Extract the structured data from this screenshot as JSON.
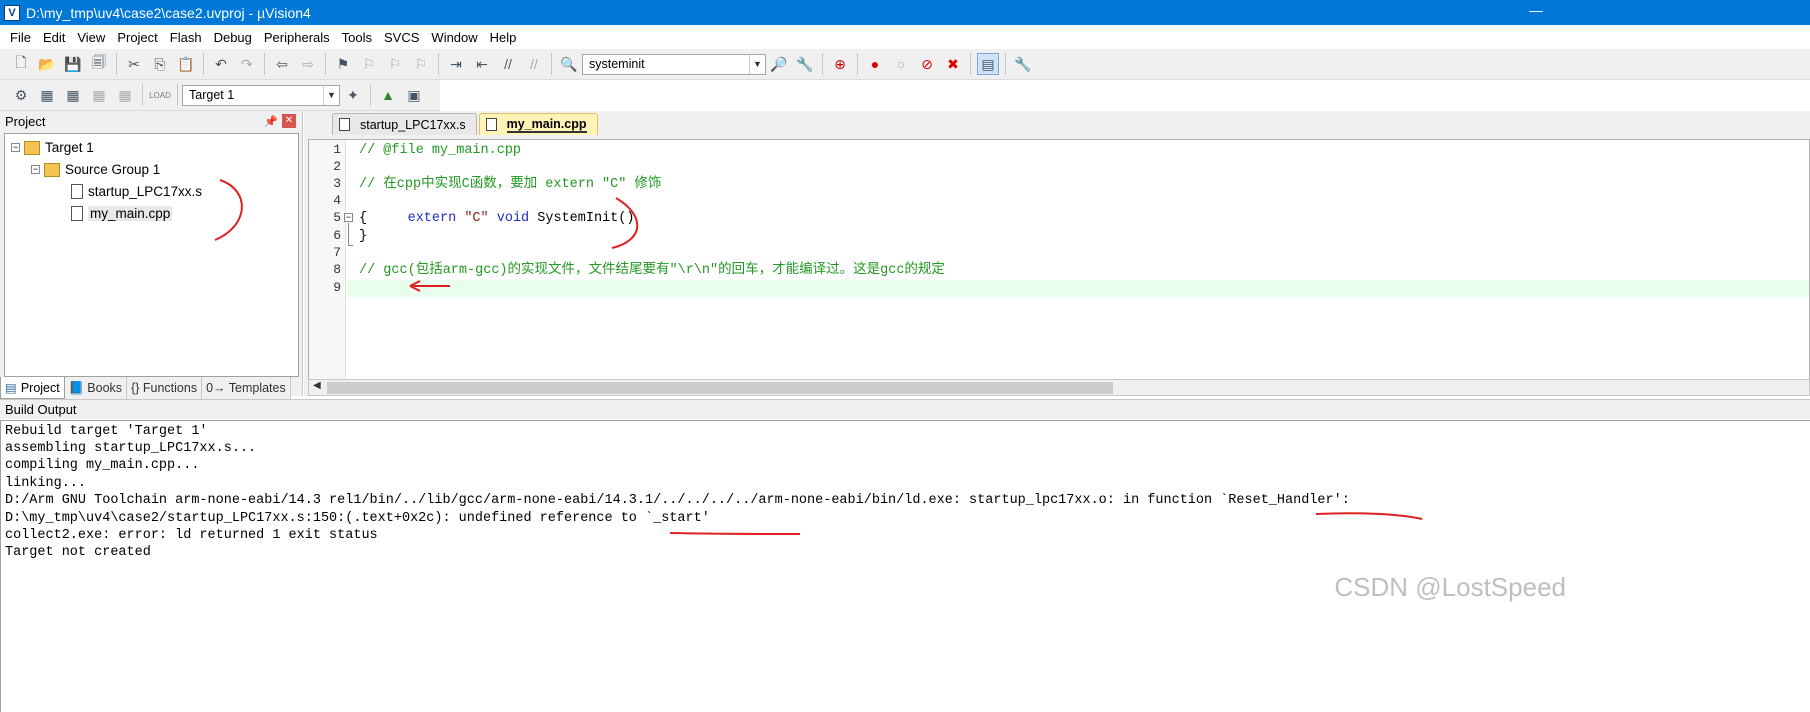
{
  "window": {
    "title": "D:\\my_tmp\\uv4\\case2\\case2.uvproj - µVision4"
  },
  "menu": [
    "File",
    "Edit",
    "View",
    "Project",
    "Flash",
    "Debug",
    "Peripherals",
    "Tools",
    "SVCS",
    "Window",
    "Help"
  ],
  "toolbar1": {
    "find_combo_value": "systeminit"
  },
  "toolbar2": {
    "load_label": "LOAD",
    "target_combo_value": "Target 1"
  },
  "project_panel": {
    "title": "Project",
    "tree": {
      "target": "Target 1",
      "group": "Source Group 1",
      "files": [
        "startup_LPC17xx.s",
        "my_main.cpp"
      ]
    },
    "tabs": [
      "Project",
      "Books",
      "{} Functions",
      "0→ Templates"
    ]
  },
  "editor": {
    "tabs": [
      {
        "label": "startup_LPC17xx.s",
        "active": false
      },
      {
        "label": "my_main.cpp",
        "active": true
      }
    ],
    "line_numbers": [
      "1",
      "2",
      "3",
      "4",
      "5",
      "6",
      "7",
      "8",
      "9"
    ],
    "lines": [
      "// @file my_main.cpp",
      "",
      "// 在cpp中实现C函数，要加 extern \"C\" 修饰",
      "extern \"C\" void SystemInit()",
      "{",
      "}",
      "",
      "// gcc(包括arm-gcc)的实现文件，文件结尾要有\"\\r\\n\"的回车，才能编译过。这是gcc的规定",
      ""
    ]
  },
  "build_output": {
    "title": "Build Output",
    "lines": [
      "Rebuild target 'Target 1'",
      "assembling startup_LPC17xx.s...",
      "compiling my_main.cpp...",
      "linking...",
      "D:/Arm GNU Toolchain arm-none-eabi/14.3 rel1/bin/../lib/gcc/arm-none-eabi/14.3.1/../../../../arm-none-eabi/bin/ld.exe: startup_lpc17xx.o: in function `Reset_Handler':",
      "D:\\my_tmp\\uv4\\case2/startup_LPC17xx.s:150:(.text+0x2c): undefined reference to `_start'",
      "collect2.exe: error: ld returned 1 exit status",
      "Target not created"
    ]
  },
  "watermark": "CSDN @LostSpeed",
  "colors": {
    "titlebar": "#0078d7",
    "comment": "#229922",
    "keyword": "#1f2bcc",
    "annotation": "#e02020"
  }
}
